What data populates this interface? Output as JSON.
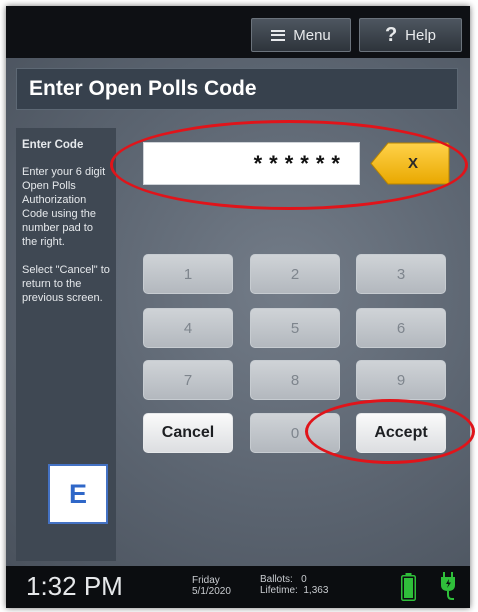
{
  "header": {
    "menu_label": "Menu",
    "help_label": "Help"
  },
  "title": "Enter Open Polls Code",
  "sidebar": {
    "heading": "Enter Code",
    "instruction": "Enter your 6 digit Open Polls Authorization Code using the number pad to the right.",
    "cancel_hint": "Select \"Cancel\" to return to the previous screen."
  },
  "code": {
    "value": "******",
    "clear_label": "X"
  },
  "keypad": {
    "keys": [
      "1",
      "2",
      "3",
      "4",
      "5",
      "6",
      "7",
      "8",
      "9"
    ],
    "cancel_label": "Cancel",
    "zero_label": "0",
    "accept_label": "Accept"
  },
  "badge": "E",
  "status": {
    "time": "1:32 PM",
    "day": "Friday",
    "date": "5/1/2020",
    "ballots_label": "Ballots:",
    "ballots_value": "0",
    "lifetime_label": "Lifetime:",
    "lifetime_value": "1,363"
  },
  "colors": {
    "accent_orange": "#f5b700",
    "annotation_red": "#e0141a",
    "battery_green": "#2fbf3a"
  }
}
